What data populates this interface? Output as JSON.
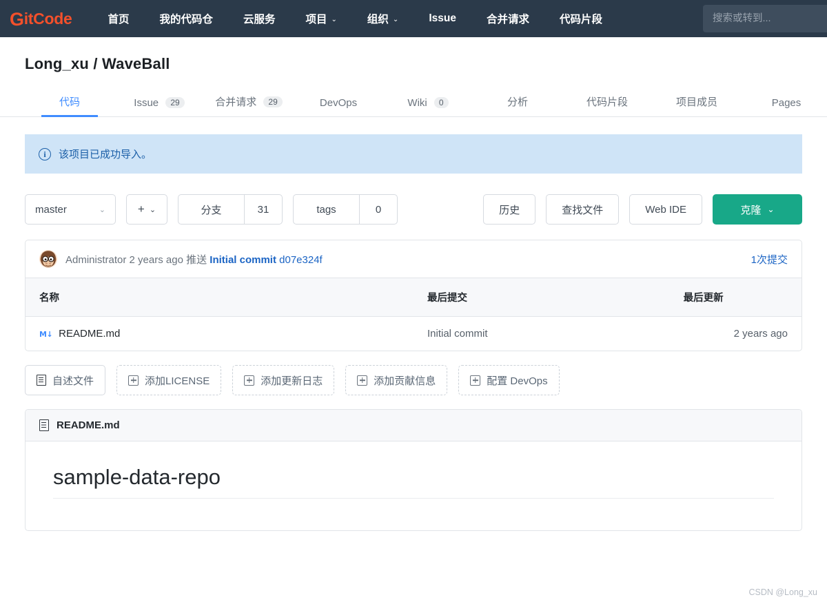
{
  "nav": {
    "logo_g": "G",
    "logo_rest": "itCode",
    "items": [
      {
        "label": "首页",
        "caret": ""
      },
      {
        "label": "我的代码仓",
        "caret": ""
      },
      {
        "label": "云服务",
        "caret": ""
      },
      {
        "label": "项目",
        "caret": "⌄"
      },
      {
        "label": "组织",
        "caret": "⌄"
      },
      {
        "label": "Issue",
        "caret": ""
      },
      {
        "label": "合并请求",
        "caret": ""
      },
      {
        "label": "代码片段",
        "caret": ""
      }
    ],
    "search_placeholder": "搜索或转到...",
    "search_value": ""
  },
  "repo": {
    "owner": "Long_xu",
    "separator": "/",
    "name": "WaveBall",
    "title": "Long_xu / WaveBall"
  },
  "tabs": [
    {
      "label": "代码",
      "count": ""
    },
    {
      "label": "Issue",
      "count": "29"
    },
    {
      "label": "合并请求",
      "count": "29"
    },
    {
      "label": "DevOps",
      "count": ""
    },
    {
      "label": "Wiki",
      "count": "0"
    },
    {
      "label": "分析",
      "count": ""
    },
    {
      "label": "代码片段",
      "count": ""
    },
    {
      "label": "项目成员",
      "count": ""
    },
    {
      "label": "Pages",
      "count": ""
    }
  ],
  "alert": {
    "icon": "info-icon",
    "text": "该项目已成功导入。"
  },
  "toolbar": {
    "branch_value": "master",
    "branch_caret": "⌄",
    "add_label": "+",
    "add_caret": "⌄",
    "branches_label": "分支",
    "branches_count": "31",
    "tags_label": "tags",
    "tags_count": "0",
    "history_label": "历史",
    "find_file_label": "查找文件",
    "web_ide_label": "Web IDE",
    "clone_label": "克隆",
    "clone_caret": "⌄"
  },
  "commit": {
    "author": "Administrator",
    "time": "2 years ago",
    "action": "推送",
    "message": "Initial commit",
    "sha": "d07e324f",
    "commit_count_label": "1次提交"
  },
  "file_table": {
    "headers": {
      "name": "名称",
      "last_commit": "最后提交",
      "last_update": "最后更新"
    },
    "rows": [
      {
        "icon": "markdown-icon",
        "icon_text": "M↓",
        "name": "README.md",
        "last_commit": "Initial commit",
        "last_update": "2 years ago"
      }
    ]
  },
  "quick_actions": [
    {
      "label": "自述文件",
      "icon": "document-icon",
      "style": "solid"
    },
    {
      "label": "添加LICENSE",
      "icon": "plus-box-icon",
      "style": "dashed"
    },
    {
      "label": "添加更新日志",
      "icon": "plus-box-icon",
      "style": "dashed"
    },
    {
      "label": "添加贡献信息",
      "icon": "plus-box-icon",
      "style": "dashed"
    },
    {
      "label": "配置 DevOps",
      "icon": "plus-box-icon",
      "style": "dashed"
    }
  ],
  "readme": {
    "header_title": "README.md",
    "heading": "sample-data-repo"
  },
  "watermark": "CSDN @Long_xu",
  "colors": {
    "nav_bg": "#2b3a4a",
    "logo": "#f4502b",
    "accent_blue": "#3f8cff",
    "link_blue": "#1b64c4",
    "clone_green": "#18a888",
    "alert_bg": "#cfe4f7",
    "alert_text": "#1b5fa8"
  }
}
